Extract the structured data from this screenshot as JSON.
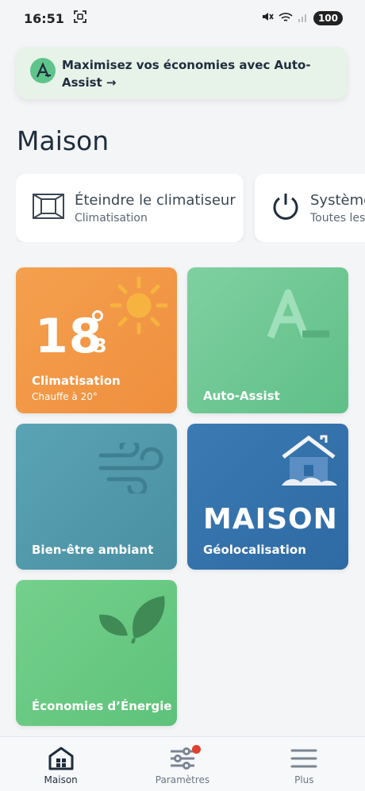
{
  "status": {
    "time": "16:51",
    "battery": "100"
  },
  "banner": {
    "text": "Maximisez vos économies avec Auto-Assist →"
  },
  "page": {
    "title": "Maison"
  },
  "shortcuts": [
    {
      "title": "Éteindre le climatiseur",
      "subtitle": "Climatisation",
      "icon": "window-ac-icon"
    },
    {
      "title": "Système",
      "subtitle": "Toutes les",
      "icon": "power-icon"
    }
  ],
  "tiles": {
    "climatisation": {
      "temp_int": "18",
      "temp_dec": "3",
      "label": "Climatisation",
      "sub": "Chauffe à 20°",
      "icon": "sun-icon"
    },
    "auto_assist": {
      "label": "Auto-Assist",
      "icon": "auto-assist-logo-icon"
    },
    "bien_etre": {
      "label": "Bien-être ambiant",
      "icon": "wind-icon"
    },
    "geoloc": {
      "big_text": "MAISON",
      "label": "Géolocalisation",
      "icon": "snowy-house-icon"
    },
    "economies": {
      "label": "Économies d’Énergie",
      "icon": "leaf-icon"
    }
  },
  "nav": [
    {
      "label": "Maison",
      "icon": "home-icon",
      "active": true
    },
    {
      "label": "Paramètres",
      "icon": "sliders-icon",
      "badge": true
    },
    {
      "label": "Plus",
      "icon": "menu-icon"
    }
  ],
  "colors": {
    "orange": "#f09446",
    "green": "#6cc793",
    "teal": "#5198ab",
    "blue": "#3472ab",
    "leaf_green": "#68c883",
    "badge": "#e0402d"
  }
}
